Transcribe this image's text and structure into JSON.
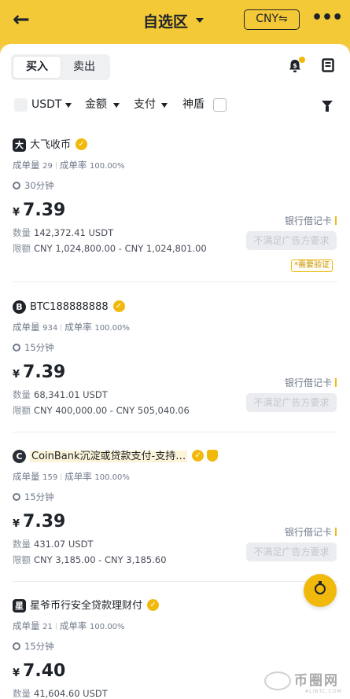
{
  "header": {
    "back_glyph": "←",
    "title": "自选区",
    "currency_label": "CNY⇋",
    "more_glyph": "•••"
  },
  "tabs": [
    {
      "label": "买入",
      "active": true
    },
    {
      "label": "卖出",
      "active": false
    }
  ],
  "header_icons": {
    "notification": "bell-dollar-icon",
    "orders": "orders-icon"
  },
  "filters": {
    "crypto": "USDT",
    "amount": "金额",
    "payment": "支付",
    "shield_label": "神盾"
  },
  "colors": {
    "brand_yellow": "#f0b90b",
    "topbar": "#f3c937"
  },
  "ads": [
    {
      "avatar": "大",
      "merchant": "大飞收币",
      "highlight": false,
      "shield": false,
      "volume_label": "成单量",
      "volume": "29",
      "rate_label": "成单率",
      "rate": "100.00%",
      "time": "30分钟",
      "currency_symbol": "¥",
      "price": "7.39",
      "qty_label": "数量",
      "qty": "142,372.41 USDT",
      "limit_label": "限额",
      "limit": "CNY 1,024,800.00 - CNY 1,024,801.00",
      "payment": "银行借记卡",
      "button": "不满足广告方要求",
      "tag": "*需要验证"
    },
    {
      "avatar": "B",
      "merchant": "BTC188888888",
      "highlight": false,
      "shield": false,
      "volume_label": "成单量",
      "volume": "934",
      "rate_label": "成单率",
      "rate": "100.00%",
      "time": "15分钟",
      "currency_symbol": "¥",
      "price": "7.39",
      "qty_label": "数量",
      "qty": "68,341.01 USDT",
      "limit_label": "限额",
      "limit": "CNY 400,000.00 - CNY 505,040.06",
      "payment": "银行借记卡",
      "button": "不满足广告方要求"
    },
    {
      "avatar": "C",
      "merchant": "CoinBank沉淀或贷款支付-支持…",
      "highlight": true,
      "shield": true,
      "volume_label": "成单量",
      "volume": "159",
      "rate_label": "成单率",
      "rate": "100.00%",
      "time": "15分钟",
      "currency_symbol": "¥",
      "price": "7.39",
      "qty_label": "数量",
      "qty": "431.07 USDT",
      "limit_label": "限额",
      "limit": "CNY 3,185.00 - CNY 3,185.60",
      "payment": "银行借记卡",
      "button": "不满足广告方要求"
    },
    {
      "avatar": "星",
      "merchant": "星爷币行安全贷款理财付",
      "highlight": false,
      "shield": false,
      "volume_label": "成单量",
      "volume": "21",
      "rate_label": "成单率",
      "rate": "100.00%",
      "time": "15分钟",
      "currency_symbol": "¥",
      "price": "7.40",
      "qty_label": "数量",
      "qty": "41,604.60 USDT"
    }
  ],
  "watermark": {
    "text": "币圈网",
    "sub": "ALIBTC.COM"
  }
}
